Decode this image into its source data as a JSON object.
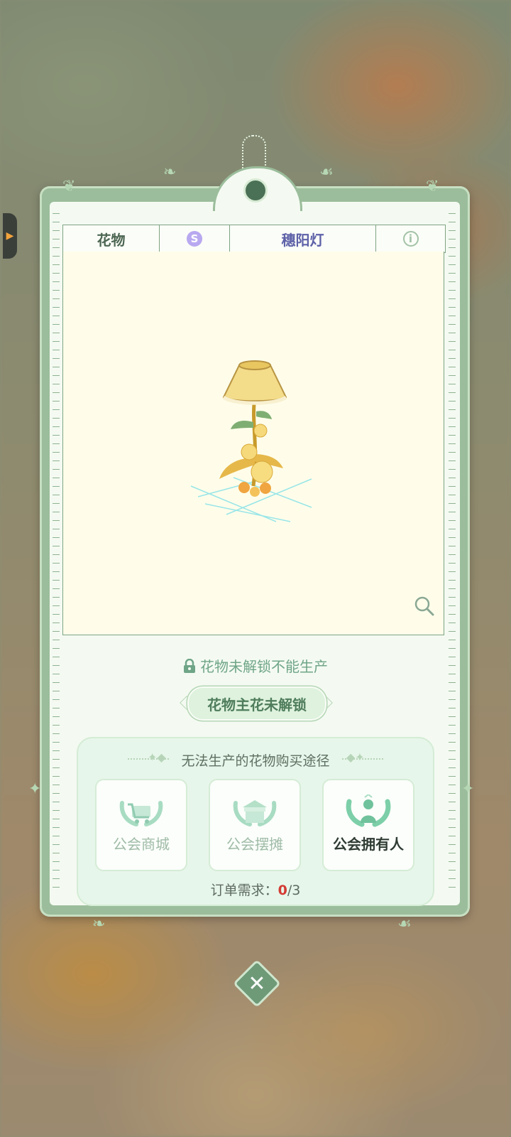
{
  "header": {
    "category": "花物",
    "badge_letter": "S",
    "item_name": "穗阳灯"
  },
  "status": {
    "lock_message": "花物未解锁不能生产",
    "unlock_tag": "花物主花未解锁"
  },
  "purchase": {
    "title": "无法生产的花物购买途径",
    "options": [
      {
        "label": "公会商城",
        "icon": "guild-shop-cart-icon",
        "active": false
      },
      {
        "label": "公会摆摊",
        "icon": "guild-stall-icon",
        "active": false
      },
      {
        "label": "公会拥有人",
        "icon": "guild-owner-icon",
        "active": true
      }
    ],
    "order_label": "订单需求：",
    "order_current": "0",
    "order_total": "/3"
  },
  "colors": {
    "accent_green": "#6fa587",
    "name_purple": "#5e62a8",
    "order_red": "#d33b34"
  }
}
